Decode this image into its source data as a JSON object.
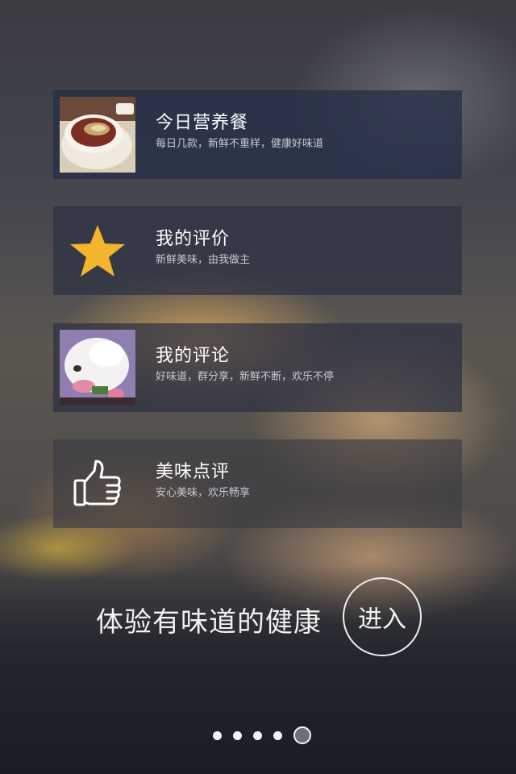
{
  "cards": [
    {
      "title": "今日营养餐",
      "subtitle": "每日几款，新鲜不重样，健康好味道",
      "icon": "soup-bowl-photo"
    },
    {
      "title": "我的评价",
      "subtitle": "新鲜美味，由我做主",
      "icon": "star-icon"
    },
    {
      "title": "我的评论",
      "subtitle": "好味道，群分享，新鲜不断，欢乐不停",
      "icon": "white-cat-photo"
    },
    {
      "title": "美味点评",
      "subtitle": "安心美味，欢乐畅享",
      "icon": "thumbs-up-icon"
    }
  ],
  "tagline": "体验有味道的健康",
  "enter_label": "进入",
  "pager": {
    "total": 5,
    "current": 5
  },
  "colors": {
    "star": "#f2b52b",
    "card_dark": "#263048"
  }
}
